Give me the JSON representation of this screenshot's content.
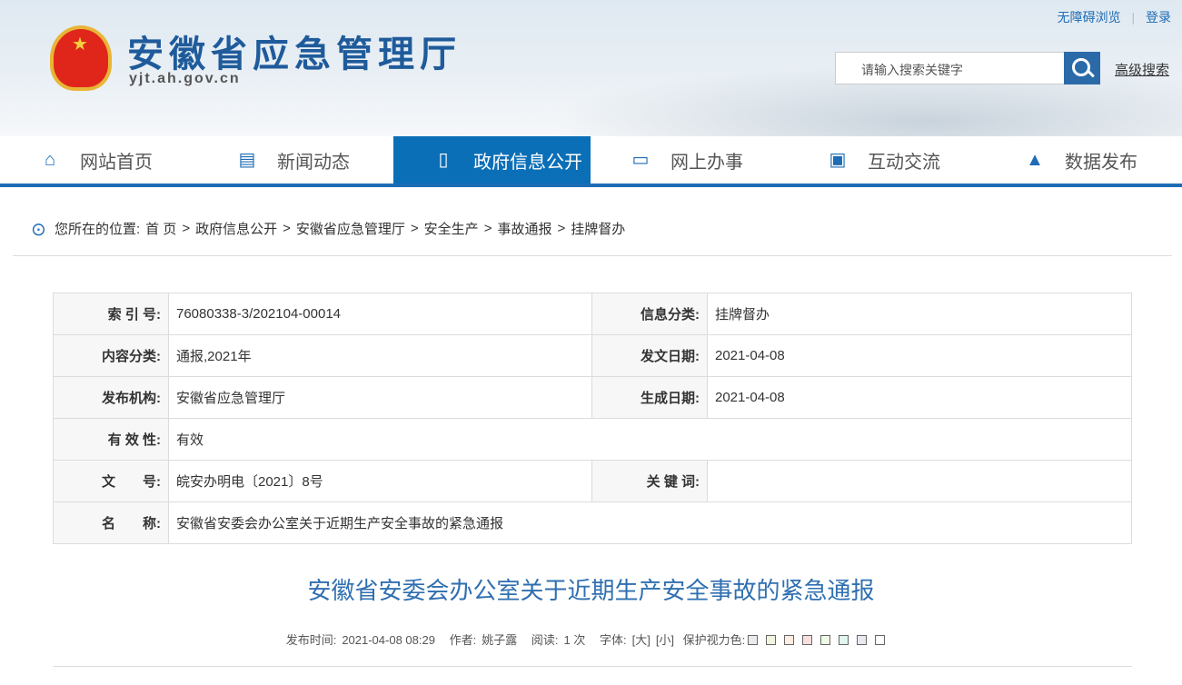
{
  "site": {
    "title": "安徽省应急管理厅",
    "domain": "yjt.ah.gov.cn"
  },
  "toplinks": {
    "accessible": "无障碍浏览",
    "login": "登录"
  },
  "search": {
    "placeholder": "请输入搜索关键字",
    "advanced": "高级搜索"
  },
  "nav": [
    {
      "label": "网站首页",
      "icon": "home-icon"
    },
    {
      "label": "新闻动态",
      "icon": "news-icon"
    },
    {
      "label": "政府信息公开",
      "icon": "document-icon",
      "active": true
    },
    {
      "label": "网上办事",
      "icon": "monitor-icon"
    },
    {
      "label": "互动交流",
      "icon": "chat-icon"
    },
    {
      "label": "数据发布",
      "icon": "chart-icon"
    }
  ],
  "breadcrumb": {
    "prefix": "您所在的位置:",
    "items": [
      "首 页",
      "政府信息公开",
      "安徽省应急管理厅",
      "安全生产",
      "事故通报",
      "挂牌督办"
    ],
    "sep": ">"
  },
  "info": {
    "index_label": "索 引 号:",
    "index": "76080338-3/202104-00014",
    "category_label": "信息分类:",
    "category": "挂牌督办",
    "content_label": "内容分类:",
    "content": "通报,2021年",
    "issue_date_label": "发文日期:",
    "issue_date": "2021-04-08",
    "org_label": "发布机构:",
    "org": "安徽省应急管理厅",
    "gen_date_label": "生成日期:",
    "gen_date": "2021-04-08",
    "validity_label": "有 效 性:",
    "validity": "有效",
    "docno_label": "文　　号:",
    "docno": "皖安办明电〔2021〕8号",
    "keywords_label": "关 键 词:",
    "keywords": "",
    "name_label": "名　　称:",
    "name": "安徽省安委会办公室关于近期生产安全事故的紧急通报"
  },
  "article": {
    "title": "安徽省安委会办公室关于近期生产安全事故的紧急通报",
    "publish_label": "发布时间:",
    "publish_time": "2021-04-08 08:29",
    "author_label": "作者:",
    "author": "姚子露",
    "read_label": "阅读:",
    "read_count": "1 次",
    "font_label": "字体:",
    "font_big": "[大]",
    "font_small": "[小]",
    "eye_label": "保护视力色:",
    "swatches": [
      "#e9ebf0",
      "#f1f5e0",
      "#fcefe2",
      "#f8e0dc",
      "#eefbe6",
      "#e0f6ef",
      "#e8e8ef",
      "#ffffff"
    ]
  }
}
